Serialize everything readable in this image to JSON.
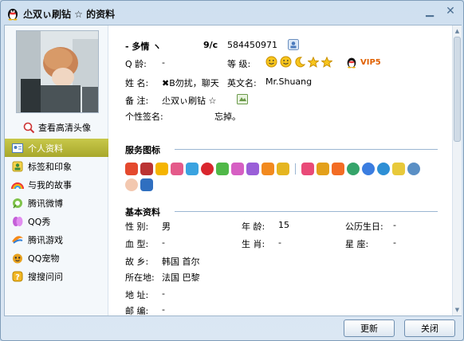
{
  "window": {
    "title": "尐双ぃ刷钻 ☆ 的资料"
  },
  "left": {
    "hd_link": "查看高清头像",
    "nav_items": [
      {
        "label": "个人资料",
        "icon": "contact-card-icon",
        "active": true
      },
      {
        "label": "标签和印象",
        "icon": "tag-icon",
        "active": false
      },
      {
        "label": "与我的故事",
        "icon": "rainbow-icon",
        "active": false
      },
      {
        "label": "腾讯微博",
        "icon": "weibo-icon",
        "active": false
      },
      {
        "label": "QQ秀",
        "icon": "qqshow-icon",
        "active": false
      },
      {
        "label": "腾讯游戏",
        "icon": "game-icon",
        "active": false
      },
      {
        "label": "QQ宠物",
        "icon": "pet-icon",
        "active": false
      },
      {
        "label": "搜搜问问",
        "icon": "question-icon",
        "active": false
      }
    ]
  },
  "profile": {
    "nickname": "- 多情 ヽ",
    "nickname_suffix": "9/c",
    "qq_number": "584450971",
    "age_label": "Q  龄:",
    "age_value": "-",
    "level_label": "等  级:",
    "vip_label": "VIP5",
    "name_label": "姓  名:",
    "name_value": "✖B勿扰，聊天",
    "english_name_label": "英文名:",
    "english_name_value": "Mr.Shuang",
    "remark_label": "备  注:",
    "remark_value": "尐双ぃ刷钻 ☆",
    "signature_label": "个性签名:",
    "signature_value": "忘掉。"
  },
  "service": {
    "title": "服务图标"
  },
  "basic": {
    "title": "基本资料",
    "fields": [
      {
        "label": "性  别:",
        "value": "男"
      },
      {
        "label": "年  龄:",
        "value": "15"
      },
      {
        "label": "公历生日:",
        "value": "-"
      },
      {
        "label": "血  型:",
        "value": "-"
      },
      {
        "label": "生  肖:",
        "value": "-"
      },
      {
        "label": "星    座:",
        "value": "-"
      },
      {
        "label": "故  乡:",
        "value": "韩国 首尔"
      },
      {
        "label": "所在地:",
        "value": "法国 巴黎"
      },
      {
        "label": "地  址:",
        "value": "-"
      },
      {
        "label": "邮  编:",
        "value": "-"
      }
    ]
  },
  "buttons": {
    "refresh": "更新",
    "close": "关闭"
  },
  "colors": {
    "active_nav": "#b5b53a",
    "section_line": "#9bb6d2",
    "vip": "#e06000"
  }
}
